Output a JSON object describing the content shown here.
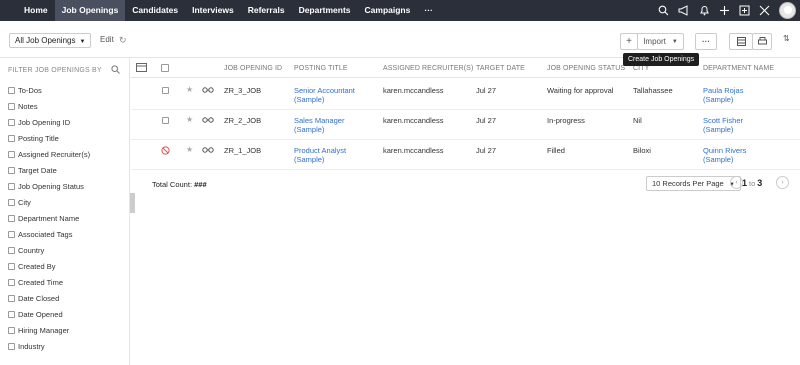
{
  "nav": {
    "tabs": [
      {
        "label": "Home",
        "active": false
      },
      {
        "label": "Job Openings",
        "active": true
      },
      {
        "label": "Candidates",
        "active": false
      },
      {
        "label": "Interviews",
        "active": false
      },
      {
        "label": "Referrals",
        "active": false
      },
      {
        "label": "Departments",
        "active": false
      },
      {
        "label": "Campaigns",
        "active": false
      },
      {
        "label": "···",
        "active": false
      }
    ]
  },
  "toolbar": {
    "view_label": "All Job Openings",
    "edit_label": "Edit",
    "import_label": "Import",
    "tooltip": "Create Job Openings"
  },
  "sidebar": {
    "header": "FILTER JOB OPENINGS BY",
    "items": [
      "To-Dos",
      "Notes",
      "Job Opening ID",
      "Posting Title",
      "Assigned Recruiter(s)",
      "Target Date",
      "Job Opening Status",
      "City",
      "Department Name",
      "Associated Tags",
      "Country",
      "Created By",
      "Created Time",
      "Date Closed",
      "Date Opened",
      "Hiring Manager",
      "Industry"
    ]
  },
  "grid": {
    "headers": [
      "JOB OPENING ID",
      "POSTING TITLE",
      "ASSIGNED RECRUITER(S)",
      "TARGET DATE",
      "JOB OPENING STATUS",
      "CITY",
      "DEPARTMENT NAME"
    ],
    "rows": [
      {
        "id": "ZR_3_JOB",
        "title": "Senior Accountant (Sample)",
        "recruiter": "karen.mccandless",
        "date": "Jul 27",
        "status": "Waiting for approval",
        "city": "Tallahassee",
        "dept": "Paula Rojas (Sample)",
        "blocked": false
      },
      {
        "id": "ZR_2_JOB",
        "title": "Sales Manager (Sample)",
        "recruiter": "karen.mccandless",
        "date": "Jul 27",
        "status": "In-progress",
        "city": "Nil",
        "dept": "Scott Fisher (Sample)",
        "blocked": false
      },
      {
        "id": "ZR_1_JOB",
        "title": "Product Analyst (Sample)",
        "recruiter": "karen.mccandless",
        "date": "Jul 27",
        "status": "Filled",
        "city": "Biloxi",
        "dept": "Quinn Rivers (Sample)",
        "blocked": true
      }
    ],
    "total_label": "Total Count:",
    "total_value": "###",
    "per_page": "10 Records Per Page",
    "page_from": "1",
    "page_to_label": "to",
    "page_to": "3"
  },
  "colors": {
    "nav_bg": "#2a2f3a",
    "link": "#2e6fcf"
  }
}
